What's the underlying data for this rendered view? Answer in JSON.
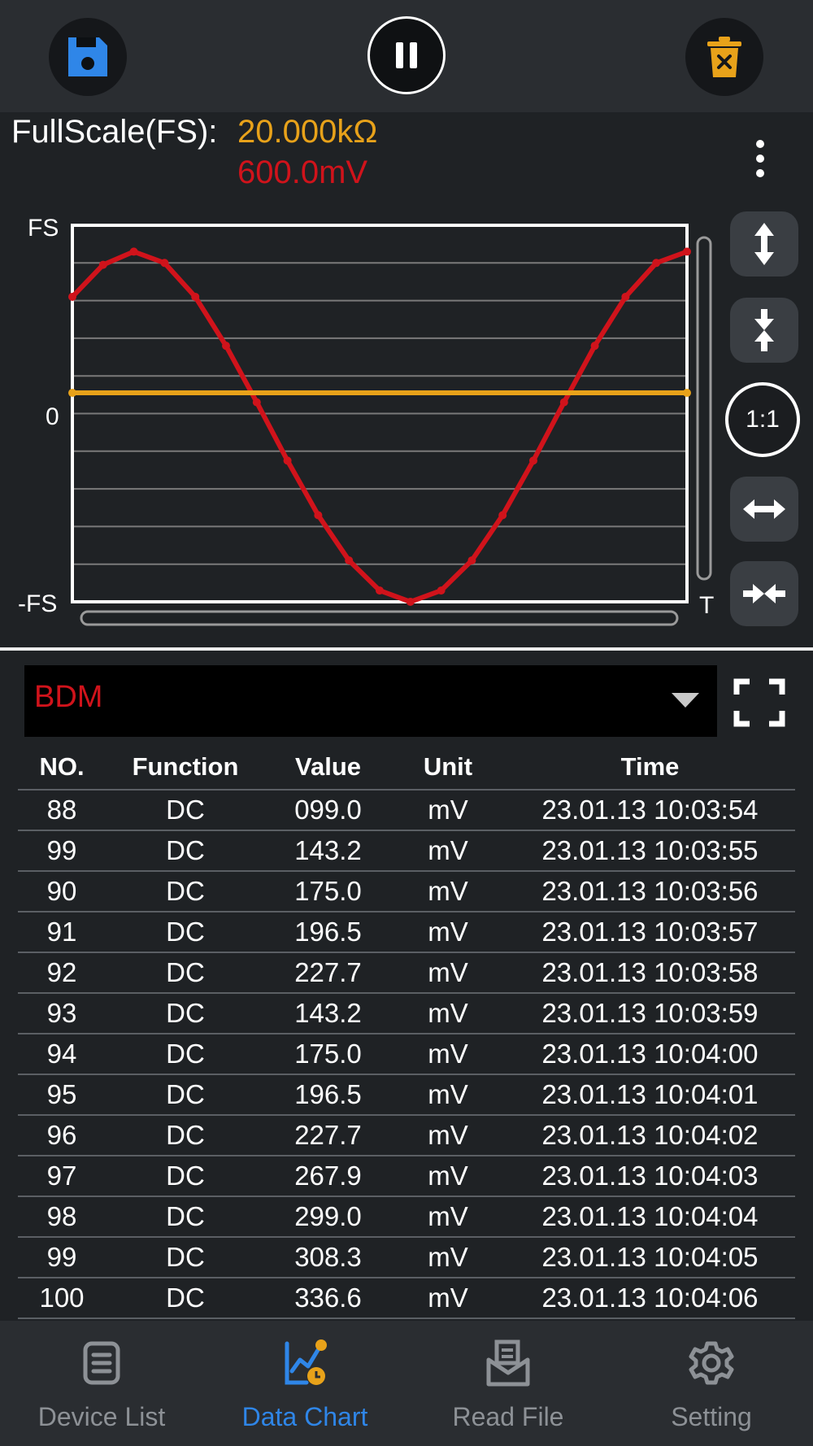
{
  "toolbar": {
    "save_icon": "floppy-disk-icon",
    "pause_icon": "pause-icon",
    "delete_icon": "trash-icon"
  },
  "header": {
    "fullscale_label": "FullScale(FS):",
    "fullscale_value": "20.000kΩ",
    "secondary_value": "600.0mV",
    "more_icon": "vertical-dots-icon"
  },
  "chart": {
    "y_top_label": "FS",
    "y_mid_label": "0",
    "y_bottom_label": "-FS",
    "x_label": "T",
    "colors": {
      "signal": "#d0131b",
      "baseline": "#e8a21a",
      "grid": "#7a7a7a",
      "frame": "#ffffff"
    }
  },
  "chart_data": {
    "type": "line",
    "ylim": [
      -1,
      1
    ],
    "grid": true,
    "series": [
      {
        "color": "#d0131b",
        "x": [
          0,
          0.05,
          0.1,
          0.15,
          0.2,
          0.25,
          0.3,
          0.35,
          0.4,
          0.45,
          0.5,
          0.55,
          0.6,
          0.65,
          0.7,
          0.75,
          0.8,
          0.85,
          0.9,
          0.95,
          1
        ],
        "values": [
          0.62,
          0.79,
          0.86,
          0.8,
          0.62,
          0.36,
          0.06,
          -0.25,
          -0.54,
          -0.78,
          -0.94,
          -1.0,
          -0.94,
          -0.78,
          -0.54,
          -0.25,
          0.06,
          0.36,
          0.62,
          0.8,
          0.86
        ]
      },
      {
        "color": "#e8a21a",
        "x": [
          0,
          1
        ],
        "values": [
          0.11,
          0.11
        ]
      }
    ]
  },
  "controls": {
    "ratio_label": "1:1",
    "expand_vertical_icon": "expand-vertical-icon",
    "compress_vertical_icon": "compress-vertical-icon",
    "expand_horizontal_icon": "expand-horizontal-icon",
    "compress_horizontal_icon": "compress-horizontal-icon"
  },
  "selector": {
    "value": "BDM",
    "fullscreen_icon": "fullscreen-icon"
  },
  "table": {
    "headers": [
      "NO.",
      "Function",
      "Value",
      "Unit",
      "Time"
    ],
    "rows": [
      [
        "88",
        "DC",
        "099.0",
        "mV",
        "23.01.13 10:03:54"
      ],
      [
        "99",
        "DC",
        "143.2",
        "mV",
        "23.01.13 10:03:55"
      ],
      [
        "90",
        "DC",
        "175.0",
        "mV",
        "23.01.13 10:03:56"
      ],
      [
        "91",
        "DC",
        "196.5",
        "mV",
        "23.01.13 10:03:57"
      ],
      [
        "92",
        "DC",
        "227.7",
        "mV",
        "23.01.13 10:03:58"
      ],
      [
        "93",
        "DC",
        "143.2",
        "mV",
        "23.01.13 10:03:59"
      ],
      [
        "94",
        "DC",
        "175.0",
        "mV",
        "23.01.13 10:04:00"
      ],
      [
        "95",
        "DC",
        "196.5",
        "mV",
        "23.01.13 10:04:01"
      ],
      [
        "96",
        "DC",
        "227.7",
        "mV",
        "23.01.13 10:04:02"
      ],
      [
        "97",
        "DC",
        "267.9",
        "mV",
        "23.01.13 10:04:03"
      ],
      [
        "98",
        "DC",
        "299.0",
        "mV",
        "23.01.13 10:04:04"
      ],
      [
        "99",
        "DC",
        "308.3",
        "mV",
        "23.01.13 10:04:05"
      ],
      [
        "100",
        "DC",
        "336.6",
        "mV",
        "23.01.13 10:04:06"
      ]
    ]
  },
  "bottom_nav": {
    "items": [
      {
        "label": "Device List",
        "icon": "device-list-icon",
        "active": false
      },
      {
        "label": "Data Chart",
        "icon": "data-chart-icon",
        "active": true
      },
      {
        "label": "Read File",
        "icon": "read-file-icon",
        "active": false
      },
      {
        "label": "Setting",
        "icon": "gear-icon",
        "active": false
      }
    ]
  }
}
